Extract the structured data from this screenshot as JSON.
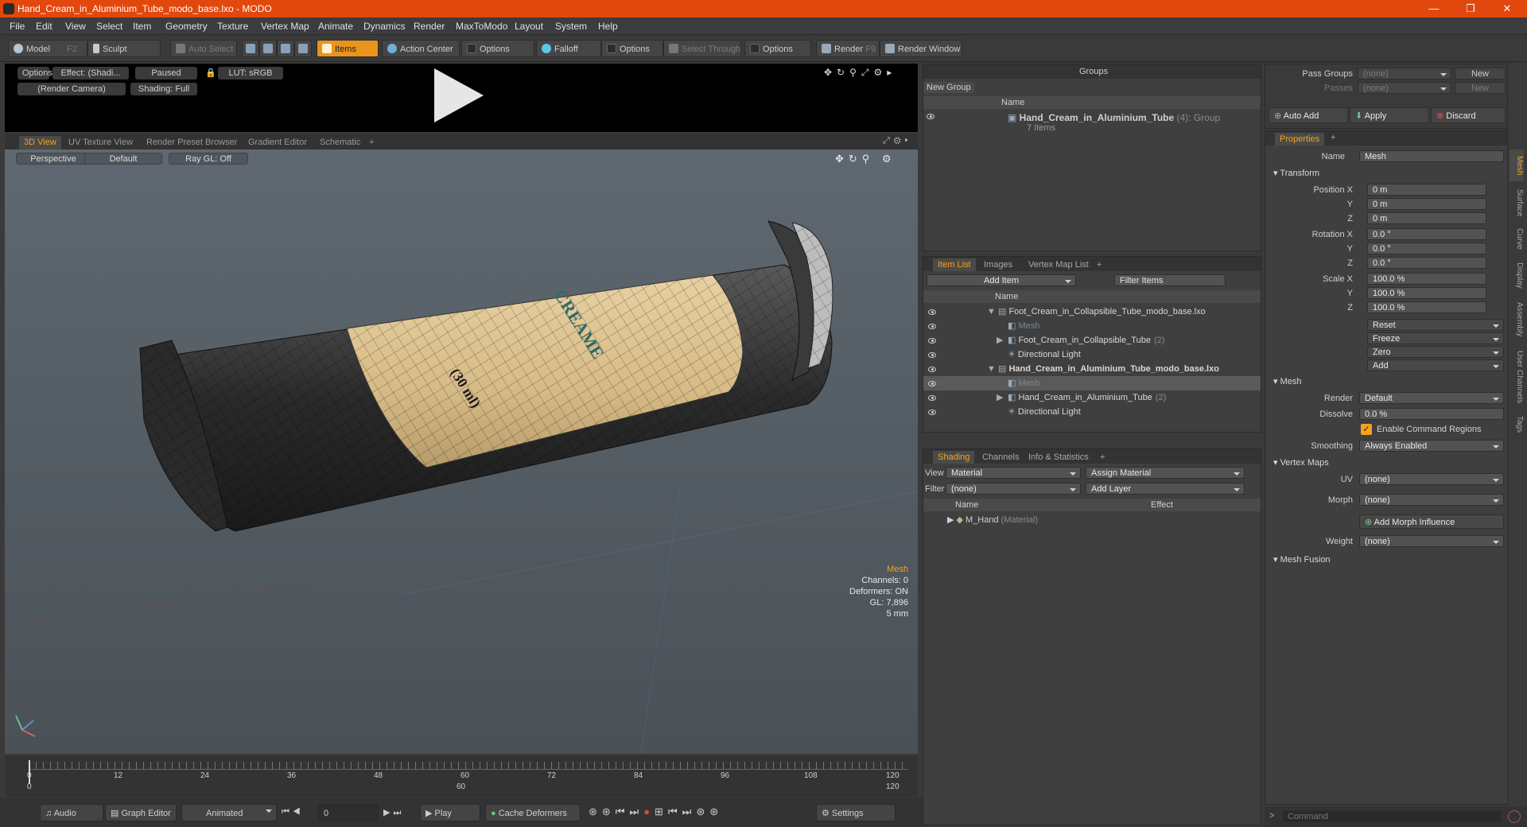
{
  "window": {
    "title": "Hand_Cream_in_Aluminium_Tube_modo_base.lxo - MODO",
    "minimize": "—",
    "restore": "❐",
    "close": "✕"
  },
  "menu": [
    "File",
    "Edit",
    "View",
    "Select",
    "Item",
    "Geometry",
    "Texture",
    "Vertex Map",
    "Animate",
    "Dynamics",
    "Render",
    "MaxToModo",
    "Layout",
    "System",
    "Help"
  ],
  "toolbar": {
    "model": "Model",
    "model_key": "F2",
    "sculpt": "Sculpt",
    "auto_select": "Auto Select",
    "items": "Items",
    "action_center": "Action Center",
    "options1": "Options",
    "falloff": "Falloff",
    "options2": "Options",
    "select_through": "Select Through",
    "options3": "Options",
    "render": "Render",
    "render_key": "F9",
    "render_window": "Render Window"
  },
  "preview": {
    "options": "Options",
    "effect": "Effect: (Shadi...",
    "paused": "Paused",
    "lut": "LUT: sRGB",
    "camera": "(Render Camera)",
    "shading": "Shading: Full"
  },
  "viewport_tabs": [
    "3D View",
    "UV Texture View",
    "Render Preset Browser",
    "Gradient Editor",
    "Schematic",
    "+"
  ],
  "viewport": {
    "projection": "Perspective",
    "style": "Default",
    "raygl": "Ray GL: Off",
    "hud": {
      "type": "Mesh",
      "channels": "Channels: 0",
      "deformers": "Deformers: ON",
      "gl": "GL: 7,896",
      "scale": "5 mm"
    },
    "label_cream": "CREAME",
    "label_ml": "(30 ml)"
  },
  "timeline": {
    "ticks": [
      "0",
      "12",
      "24",
      "36",
      "48",
      "60",
      "72",
      "84",
      "96",
      "108",
      "120"
    ],
    "sub_ticks": [
      "0",
      "60",
      "120"
    ]
  },
  "bottom": {
    "audio": "Audio",
    "graph_editor": "Graph Editor",
    "animated": "Animated",
    "frame": "0",
    "play": "Play",
    "cache": "Cache Deformers",
    "settings": "Settings"
  },
  "groups": {
    "title": "Groups",
    "new_group": "New Group",
    "col_name": "Name",
    "item_name": "Hand_Cream_in_Aluminium_Tube",
    "item_count": "(4)",
    "item_type": ": Group",
    "item_sub": "7 Items"
  },
  "itemlist": {
    "tabs": [
      "Item List",
      "Images",
      "Vertex Map List",
      "+"
    ],
    "add_item": "Add Item",
    "filter": "Filter Items",
    "col_name": "Name",
    "rows": [
      {
        "indent": 0,
        "arrow": "▼",
        "text": "Foot_Cream_in_Collapsible_Tube_modo_base.lxo",
        "bold": false,
        "dim": false
      },
      {
        "indent": 1,
        "arrow": "",
        "text": "Mesh",
        "bold": false,
        "dim": true
      },
      {
        "indent": 1,
        "arrow": "▶",
        "text": "Foot_Cream_in_Collapsible_Tube",
        "extra": "(2)",
        "bold": false,
        "dim": false
      },
      {
        "indent": 1,
        "arrow": "",
        "text": "Directional Light",
        "bold": false,
        "dim": false
      },
      {
        "indent": 0,
        "arrow": "▼",
        "text": "Hand_Cream_in_Aluminium_Tube_modo_base.lxo",
        "bold": true,
        "dim": false
      },
      {
        "indent": 1,
        "arrow": "",
        "text": "Mesh",
        "bold": false,
        "dim": true,
        "sel": true
      },
      {
        "indent": 1,
        "arrow": "▶",
        "text": "Hand_Cream_in_Aluminium_Tube",
        "extra": "(2)",
        "bold": false,
        "dim": false
      },
      {
        "indent": 1,
        "arrow": "",
        "text": "Directional Light",
        "bold": false,
        "dim": false
      }
    ]
  },
  "shading": {
    "tabs": [
      "Shading",
      "Channels",
      "Info & Statistics",
      "+"
    ],
    "view_label": "View",
    "view_value": "Material",
    "assign": "Assign Material",
    "filter_label": "Filter",
    "filter_value": "(none)",
    "add_layer": "Add Layer",
    "col_name": "Name",
    "col_effect": "Effect",
    "row_name": "M_Hand",
    "row_type": "(Material)"
  },
  "passes": {
    "pass_groups": "Pass Groups",
    "passes": "Passes",
    "none1": "(none)",
    "none2": "(none)",
    "new1": "New",
    "new2": "New",
    "auto_add": "Auto Add",
    "apply": "Apply",
    "discard": "Discard"
  },
  "properties": {
    "tab": "Properties",
    "name_label": "Name",
    "name_value": "Mesh",
    "transform": "Transform",
    "pos_label": "Position X",
    "rot_label": "Rotation X",
    "scale_label": "Scale X",
    "y": "Y",
    "z": "Z",
    "pos": [
      "0 m",
      "0 m",
      "0 m"
    ],
    "rot": [
      "0.0 °",
      "0.0 °",
      "0.0 °"
    ],
    "scl": [
      "100.0 %",
      "100.0 %",
      "100.0 %"
    ],
    "reset": "Reset",
    "freeze": "Freeze",
    "zero": "Zero",
    "add": "Add",
    "mesh": "Mesh",
    "render_label": "Render",
    "render_value": "Default",
    "dissolve_label": "Dissolve",
    "dissolve_value": "0.0 %",
    "enable_cmd": "Enable Command Regions",
    "smoothing_label": "Smoothing",
    "smoothing_value": "Always Enabled",
    "vertex_maps": "Vertex Maps",
    "uv_label": "UV",
    "uv_value": "(none)",
    "morph_label": "Morph",
    "morph_value": "(none)",
    "add_morph": "Add Morph Influence",
    "weight_label": "Weight",
    "weight_value": "(none)",
    "mesh_fusion": "Mesh Fusion",
    "command": "Command"
  },
  "side_tabs": [
    "Mesh",
    "Surface",
    "Curve",
    "Display",
    "Assembly",
    "User Channels",
    "Tags"
  ]
}
